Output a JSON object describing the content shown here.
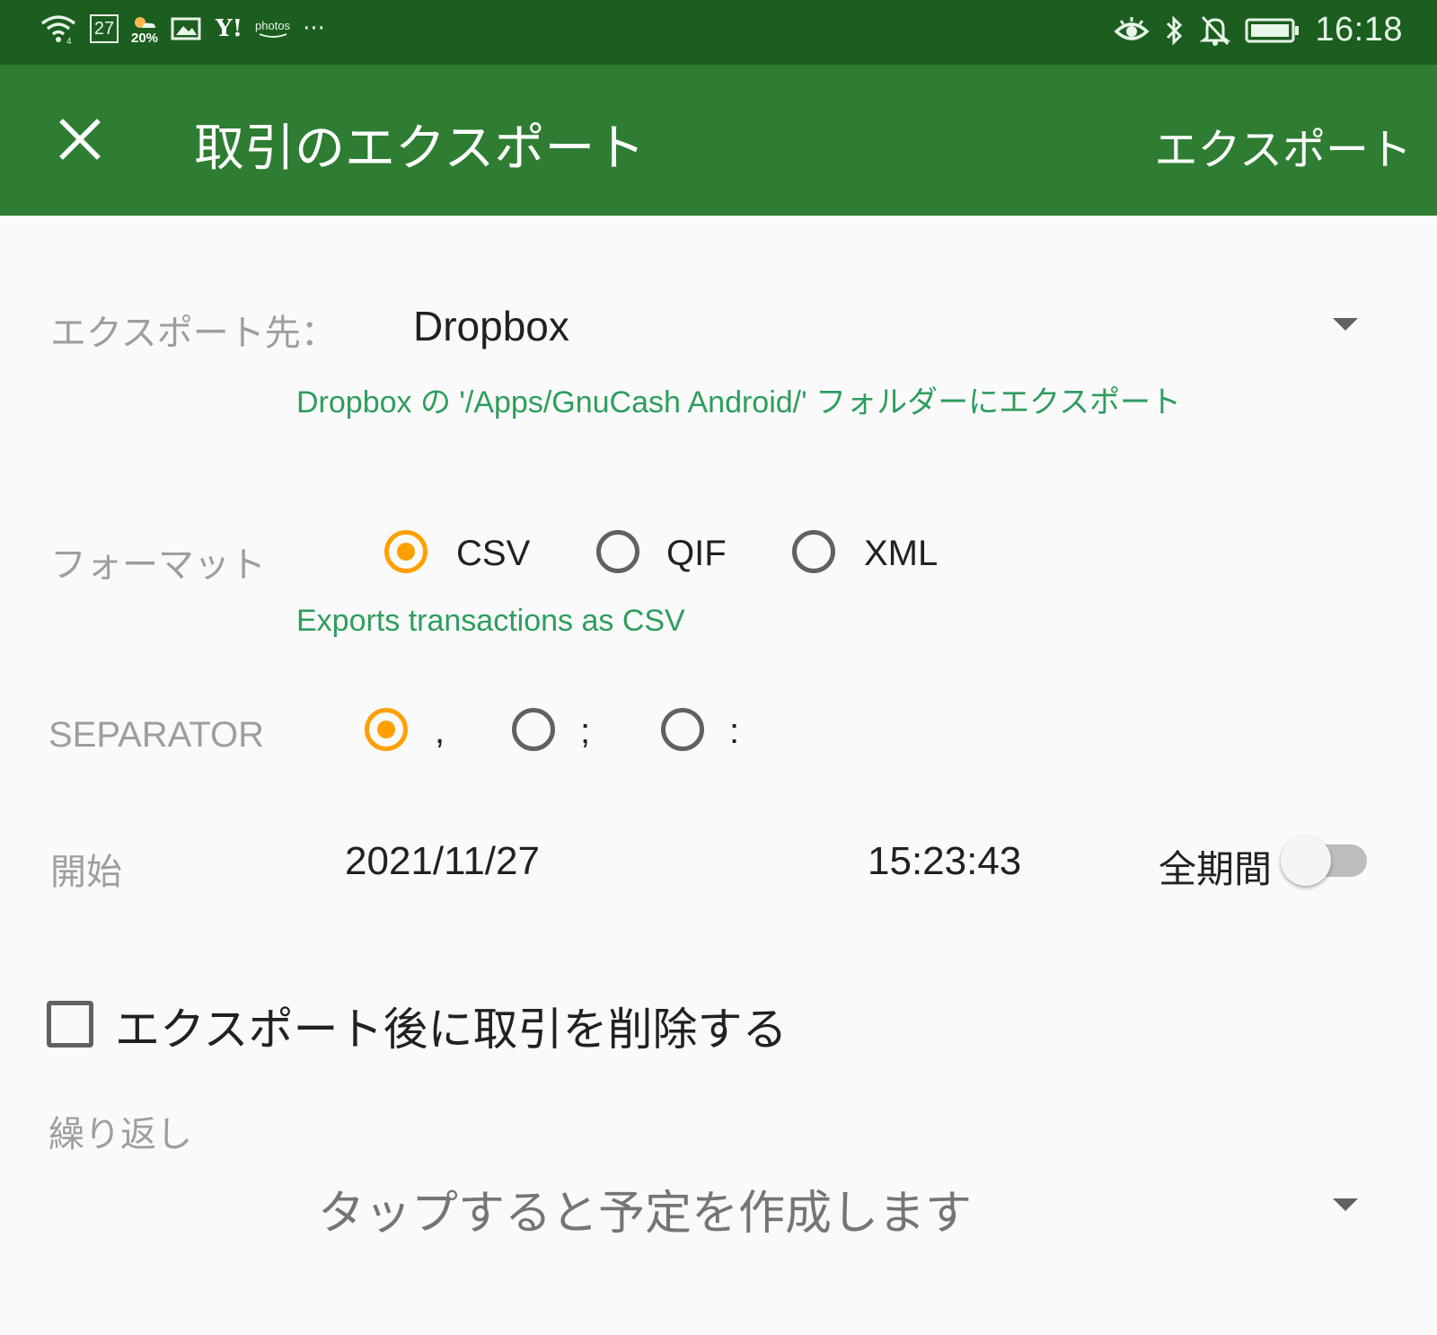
{
  "status_bar": {
    "calendar_day": "27",
    "weather_percent": "20%",
    "amazon_text": "photos",
    "yahoo_text": "Y!",
    "more": "···",
    "time": "16:18",
    "icons_left": [
      "wifi-icon",
      "calendar-icon",
      "weather-icon",
      "gallery-icon",
      "yahoo-icon",
      "amazon-photos-icon",
      "more-icon"
    ],
    "icons_right": [
      "eye-comfort-icon",
      "bluetooth-icon",
      "notifications-off-icon",
      "battery-icon"
    ]
  },
  "appbar": {
    "close_icon": "close-icon",
    "title": "取引のエクスポート",
    "action": "エクスポート",
    "color": "#2e7d32"
  },
  "destination": {
    "label": "エクスポート先：",
    "value": "Dropbox",
    "hint": "Dropbox の '/Apps/GnuCash Android/' フォルダーにエクスポート"
  },
  "format": {
    "label": "フォーマット",
    "options": [
      "CSV",
      "QIF",
      "XML"
    ],
    "selected": "CSV",
    "hint": "Exports transactions as CSV"
  },
  "separator": {
    "label": "SEPARATOR",
    "options": [
      ",",
      ";",
      ":"
    ],
    "selected": ","
  },
  "start": {
    "label": "開始",
    "date": "2021/11/27",
    "time": "15:23:43",
    "all_period_label": "全期間",
    "all_period_on": false
  },
  "delete_after": {
    "label": "エクスポート後に取引を削除する",
    "checked": false
  },
  "recurrence": {
    "label": "繰り返し",
    "placeholder": "タップすると予定を作成します"
  },
  "colors": {
    "accent": "#ffa000",
    "hint": "#2e9d5e",
    "status_bar": "#1b5e20"
  }
}
